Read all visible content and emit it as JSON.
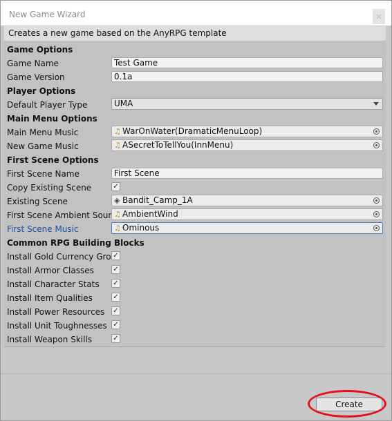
{
  "window": {
    "title": "New Game Wizard",
    "close_label": "×"
  },
  "header": {
    "description": "Creates a new game based on the AnyRPG template"
  },
  "sections": {
    "game_options": "Game Options",
    "player_options": "Player Options",
    "main_menu_options": "Main Menu Options",
    "first_scene_options": "First Scene Options",
    "building_blocks": "Common RPG Building Blocks"
  },
  "fields": {
    "game_name": {
      "label": "Game Name",
      "value": "Test Game"
    },
    "game_version": {
      "label": "Game Version",
      "value": "0.1a"
    },
    "default_player_type": {
      "label": "Default Player Type",
      "value": "UMA"
    },
    "main_menu_music": {
      "label": "Main Menu Music",
      "value": "WarOnWater(DramaticMenuLoop)"
    },
    "new_game_music": {
      "label": "New Game Music",
      "value": "ASecretToTellYou(InnMenu)"
    },
    "first_scene_name": {
      "label": "First Scene Name",
      "value": "First Scene"
    },
    "copy_existing_scene": {
      "label": "Copy Existing Scene",
      "checked": true
    },
    "existing_scene": {
      "label": "Existing Scene",
      "value": "Bandit_Camp_1A"
    },
    "first_scene_ambient_sound": {
      "label": "First Scene Ambient Sounds",
      "value": "AmbientWind"
    },
    "first_scene_music": {
      "label": "First Scene Music",
      "value": "Ominous"
    }
  },
  "building_blocks": [
    {
      "label": "Install Gold Currency Group",
      "checked": true
    },
    {
      "label": "Install Armor Classes",
      "checked": true
    },
    {
      "label": "Install Character Stats",
      "checked": true
    },
    {
      "label": "Install Item Qualities",
      "checked": true
    },
    {
      "label": "Install Power Resources",
      "checked": true
    },
    {
      "label": "Install Unit Toughnesses",
      "checked": true
    },
    {
      "label": "Install Weapon Skills",
      "checked": true
    }
  ],
  "footer": {
    "create_label": "Create"
  },
  "icons": {
    "audio": "audio-clip-icon",
    "scene": "scene-asset-icon",
    "picker": "object-picker-icon",
    "check": "✓"
  },
  "colors": {
    "active_label": "#1c4fa0",
    "annotation": "#e3101c"
  }
}
